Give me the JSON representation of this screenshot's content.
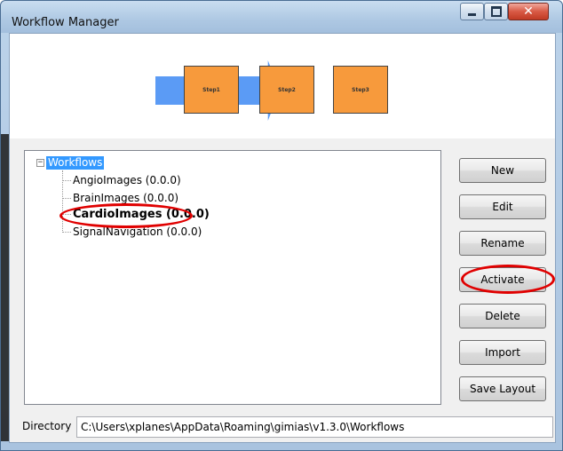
{
  "window": {
    "title": "Workflow Manager"
  },
  "diagram": {
    "steps": [
      "Step1",
      "Step2",
      "Step3"
    ]
  },
  "tree": {
    "root": {
      "label": "Workflows",
      "expander": "−"
    },
    "items": [
      {
        "label": "AngioImages (0.0.0)",
        "active": false
      },
      {
        "label": "BrainImages (0.0.0)",
        "active": false
      },
      {
        "label": "CardioImages (0.0.0)",
        "active": true
      },
      {
        "label": "SignalNavigation (0.0.0)",
        "active": false
      }
    ]
  },
  "buttons": {
    "new": "New",
    "edit": "Edit",
    "rename": "Rename",
    "activate": "Activate",
    "delete": "Delete",
    "import": "Import",
    "save_layout": "Save Layout"
  },
  "directory": {
    "label": "Directory",
    "value": "C:\\Users\\xplanes\\AppData\\Roaming\\gimias\\v1.3.0\\Workflows"
  },
  "title_buttons": {
    "close": "✕"
  },
  "colors": {
    "annotation": "#e00000",
    "step_fill": "#f79a3c",
    "arrow_fill": "#5b9bf5",
    "selection": "#3399ff"
  }
}
